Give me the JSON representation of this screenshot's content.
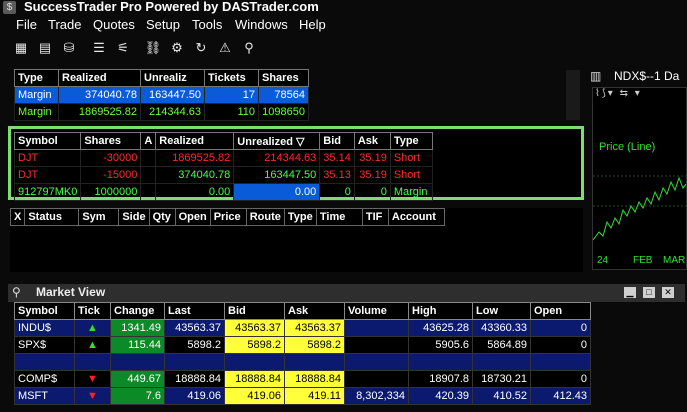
{
  "app": {
    "title": "SuccessTrader Pro Powered by DASTrader.com",
    "icon": "app-logo"
  },
  "menu": [
    "File",
    "Trade",
    "Quotes",
    "Setup",
    "Tools",
    "Windows",
    "Help"
  ],
  "toolbar_icons": [
    "montage-icon",
    "chart-icon",
    "portfolio-icon",
    "list-icon",
    "filter-icon",
    "link-icon",
    "settings-icon",
    "refresh-icon",
    "alert-icon",
    "scan-icon"
  ],
  "account": {
    "headers": [
      "Type",
      "Realized",
      "Unrealiz",
      "Tickets",
      "Shares"
    ],
    "rows": [
      [
        "Margin",
        "374040.78",
        "163447.50",
        "17",
        "78564"
      ],
      [
        "Margin",
        "1869525.82",
        "214344.63",
        "110",
        "1098650"
      ]
    ]
  },
  "positions": {
    "headers": [
      "Symbol",
      "Shares",
      "A",
      "Realized",
      "Unrealized",
      "Bid",
      "Ask",
      "Type"
    ],
    "rows": [
      [
        "DJT",
        "-30000",
        "",
        "1869525.82",
        "214344.63",
        "35.14",
        "35.19",
        "Short"
      ],
      [
        "DJT",
        "-15000",
        "",
        "374040.78",
        "163447.50",
        "35.13",
        "35.19",
        "Short"
      ],
      [
        "912797MK0",
        "1000000",
        "",
        "0.00",
        "0.00",
        "0",
        "0",
        "Margin"
      ]
    ]
  },
  "orders": {
    "headers": [
      "X",
      "Status",
      "Sym",
      "Side",
      "Qty",
      "Open",
      "Price",
      "Route",
      "Type",
      "Time",
      "TIF",
      "Account"
    ]
  },
  "chart": {
    "title": "NDX$--1 Da",
    "line_label": "Price (Line)",
    "x_label_1": "24",
    "x_label_2": "FEB",
    "x_label_3": "MAR"
  },
  "market_view": {
    "title": "Market View",
    "headers": [
      "Symbol",
      "Tick",
      "Change",
      "Last",
      "Bid",
      "Ask",
      "Volume",
      "High",
      "Low",
      "Open"
    ],
    "rows": [
      {
        "symbol": "INDU$",
        "tick": "up",
        "change": "1341.49",
        "last": "43563.37",
        "bid": "43563.37",
        "ask": "43563.37",
        "volume": "",
        "high": "43625.28",
        "low": "43360.33",
        "open": "0"
      },
      {
        "symbol": "SPX$",
        "tick": "up",
        "change": "115.44",
        "last": "5898.2",
        "bid": "5898.2",
        "ask": "5898.2",
        "volume": "",
        "high": "5905.6",
        "low": "5864.89",
        "open": "0"
      },
      {
        "symbol": "",
        "tick": "",
        "change": "",
        "last": "",
        "bid": "",
        "ask": "",
        "volume": "",
        "high": "",
        "low": "",
        "open": ""
      },
      {
        "symbol": "COMP$",
        "tick": "down",
        "change": "449.67",
        "last": "18888.84",
        "bid": "18888.84",
        "ask": "18888.84",
        "volume": "",
        "high": "18907.8",
        "low": "18730.21",
        "open": "0"
      },
      {
        "symbol": "MSFT",
        "tick": "down",
        "change": "7.6",
        "last": "419.06",
        "bid": "419.06",
        "ask": "419.11",
        "volume": "8,302,334",
        "high": "420.39",
        "low": "410.52",
        "open": "412.43"
      }
    ]
  },
  "colors": {
    "highlight_border": "#7bde6e",
    "selected_row": "#0a5bd8",
    "quote_yellow": "#ffff3a",
    "change_green": "#0c8a28",
    "row_navy": "#0b1a6e"
  }
}
